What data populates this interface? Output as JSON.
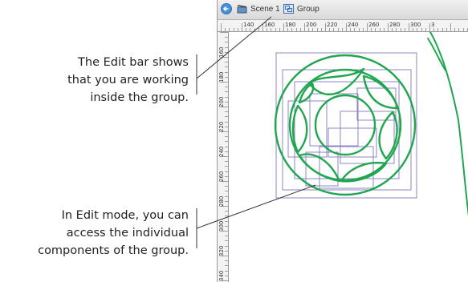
{
  "callouts": {
    "edit_bar": {
      "lines": [
        "The Edit bar shows",
        "that you are working",
        "inside the group."
      ]
    },
    "edit_mode": {
      "lines": [
        "In Edit mode, you can",
        "access the individual",
        "components of the group."
      ]
    }
  },
  "edit_bar": {
    "scene_label": "Scene 1",
    "group_label": "Group"
  },
  "rulers": {
    "x_labels": [
      "140",
      "160",
      "180",
      "200",
      "220",
      "240",
      "260",
      "280",
      "300",
      "3"
    ],
    "y_labels": [
      "160",
      "180",
      "200",
      "220",
      "240",
      "260",
      "280",
      "300",
      "320",
      "340"
    ]
  },
  "colors": {
    "shape_stroke": "#21a650",
    "selection_box": "#8b86c4",
    "callout_line": "#333333"
  },
  "icons": {
    "back": "back-arrow-icon",
    "scene": "scene-clapper-icon",
    "group": "group-icon"
  }
}
